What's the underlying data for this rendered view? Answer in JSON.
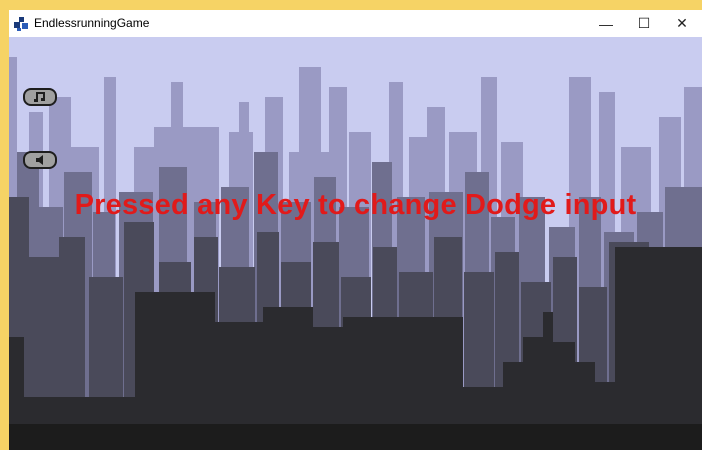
{
  "window": {
    "title": "EndlessrunningGame",
    "controls": {
      "minimize": "—",
      "maximize": "☐",
      "close": "✕"
    }
  },
  "game": {
    "message": "Pressed any Key to change Dodge input",
    "message_color": "#e11a1a",
    "buttons": [
      {
        "name": "music-toggle",
        "icon": "music-note-icon"
      },
      {
        "name": "sound-toggle",
        "icon": "speaker-icon"
      }
    ],
    "palette": {
      "sky": "#c9ccf0",
      "far_city": "#9a9ac4",
      "mid_city": "#6f6f8f",
      "near_city": "#4a4a5a",
      "front_city": "#2b2b2f",
      "ground": "#1c1c1c"
    }
  }
}
